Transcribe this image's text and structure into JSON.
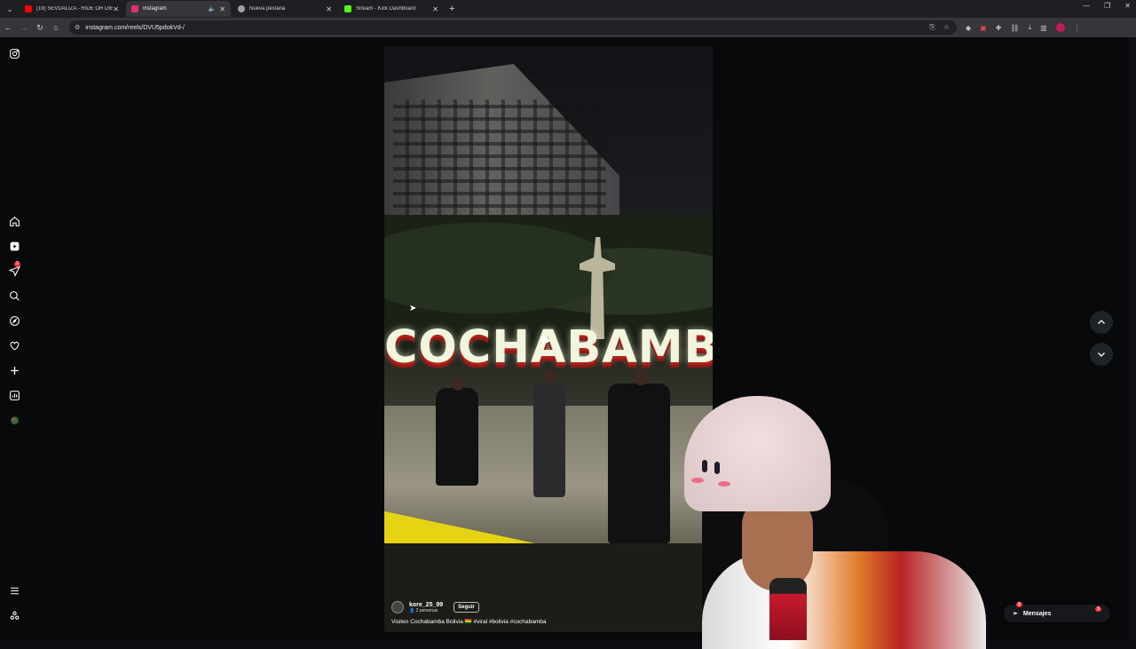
{
  "browser": {
    "tabs": [
      {
        "title": "(19) SEVDALIZA - RIDE OR DIE",
        "favicon_color": "#ff0000",
        "active": false
      },
      {
        "title": "Instagram",
        "favicon_color": "#e1306c",
        "active": true
      },
      {
        "title": "Nueva pestaña",
        "favicon_color": "#9aa0a6",
        "active": false
      },
      {
        "title": "Stream - Kick Dashboard",
        "favicon_color": "#53fc18",
        "active": false
      }
    ],
    "url": "instagram.com/reels/DVU5pdokVd-/"
  },
  "sidebar": {
    "notification_count": "2"
  },
  "reel": {
    "sign_text": "COCHABAMBA",
    "author": "kore_25_99",
    "collab": "2 personas",
    "follow_label": "Seguir",
    "caption": "Visiten Cochabamba Bolivia 🇧🇴 #viral #bolivia #cochabamba"
  },
  "messages": {
    "label": "Mensajes",
    "badge": "2",
    "badge2": "1"
  }
}
